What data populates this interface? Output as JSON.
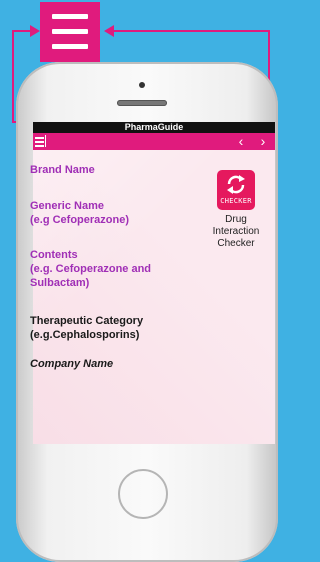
{
  "app": {
    "title": "PharmaGuide"
  },
  "fields": {
    "brand_name": "Brand Name",
    "generic_name_1": "Generic Name",
    "generic_name_2": "(e.g Cefoperazone)",
    "contents_1": "Contents",
    "contents_2": "(e.g. Cefoperazone and",
    "contents_3": "Sulbactam)",
    "therapeutic_1": "Therapeutic Category",
    "therapeutic_2": "(e.g.Cephalosporins)",
    "company_name": "Company Name"
  },
  "checker": {
    "tile_text": "CHECKER",
    "caption_1": "Drug",
    "caption_2": "Interaction",
    "caption_3": "Checker"
  },
  "nav": {
    "back_glyph": "‹",
    "forward_glyph": "›"
  },
  "colors": {
    "accent": "#e01b7d",
    "purple_text": "#a02fb6",
    "background": "#3fb1e3",
    "screen": "#fbe9ef"
  },
  "icons": [
    "hamburger-menu-icon",
    "drug-interaction-checker-icon",
    "back-arrow-icon",
    "forward-arrow-icon"
  ]
}
